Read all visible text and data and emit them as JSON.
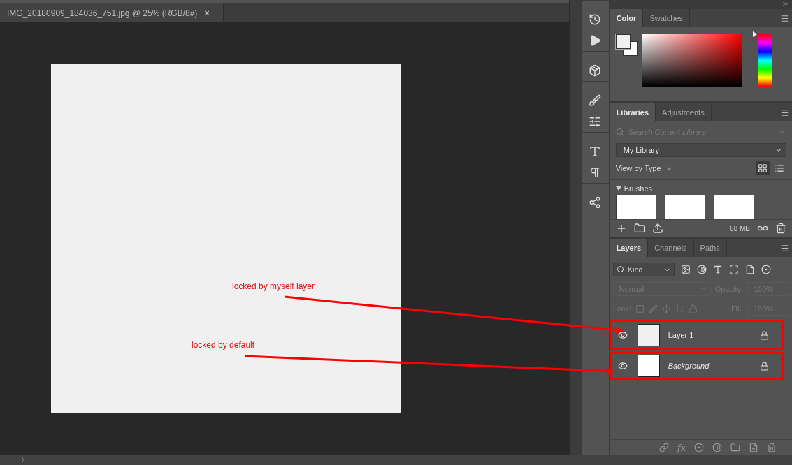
{
  "document_tab": {
    "title": "IMG_20180909_184036_751.jpg @ 25% (RGB/8#)",
    "close": "×"
  },
  "status_bar": {
    "toggle": "〉"
  },
  "annotations": [
    {
      "text": "locked by myself layer"
    },
    {
      "text": "locked by default"
    }
  ],
  "color_panel": {
    "tabs": [
      {
        "label": "Color",
        "selected": true
      },
      {
        "label": "Swatches",
        "selected": false
      }
    ],
    "hue": {
      "level": 1
    }
  },
  "libraries_panel": {
    "tabs": [
      {
        "label": "Libraries",
        "selected": true
      },
      {
        "label": "Adjustments",
        "selected": false
      }
    ],
    "search": {
      "placeholder": "Search Current Library"
    },
    "library": "My Library",
    "view": "View by Type",
    "section": {
      "title": "Brushes",
      "expanded": true
    },
    "storage": "68 MB"
  },
  "layers_panel": {
    "tabs": [
      {
        "label": "Layers",
        "selected": true
      },
      {
        "label": "Channels",
        "selected": false
      },
      {
        "label": "Paths",
        "selected": false
      }
    ],
    "filter": "Kind",
    "blend_mode": "Normal",
    "opacity_label": "Opacity:",
    "opacity": "100%",
    "lock_label": "Lock:",
    "fill_label": "Fill:",
    "fill": "100%",
    "footer_fx": "fx",
    "layers": [
      {
        "name": "Layer 1",
        "kind": "layer",
        "visible": true,
        "locked": true,
        "highlighted": true
      },
      {
        "name": "Background",
        "kind": "background",
        "visible": true,
        "locked": true,
        "highlighted": true
      }
    ]
  }
}
